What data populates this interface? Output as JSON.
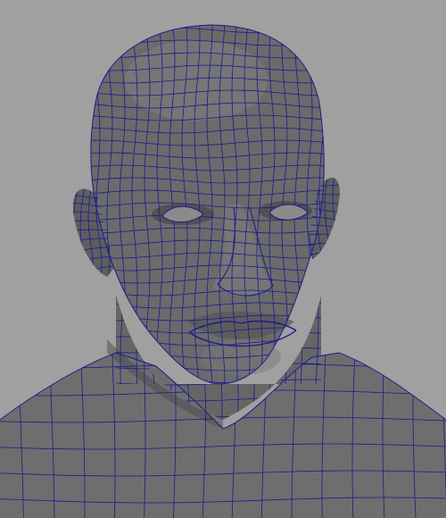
{
  "viewport": {
    "background_color": "#a0a0a0",
    "mesh_fill_color": "#6b6b6b",
    "mesh_shadow_color": "#3f3f3f",
    "mesh_highlight_color": "#8a8a8a",
    "wireframe_color": "#1e1a8c",
    "display_mode": "shaded-with-wireframe",
    "subject": "head-and-shoulders-mesh"
  }
}
